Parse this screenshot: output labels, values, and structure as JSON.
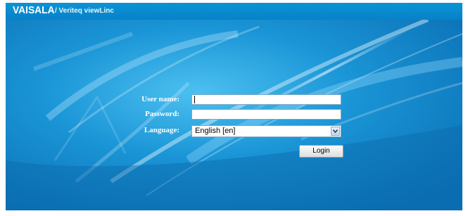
{
  "header": {
    "brand": "VAISALA",
    "product": "/ Veriteq viewLinc"
  },
  "login": {
    "username_label": "User name:",
    "username_value": "",
    "password_label": "Password:",
    "password_value": "",
    "language_label": "Language:",
    "language_selected": "English [en]",
    "login_button": "Login"
  },
  "colors": {
    "background": "#0a7fc4",
    "header": "#0b8fd2",
    "label_text": "#ffffff"
  }
}
